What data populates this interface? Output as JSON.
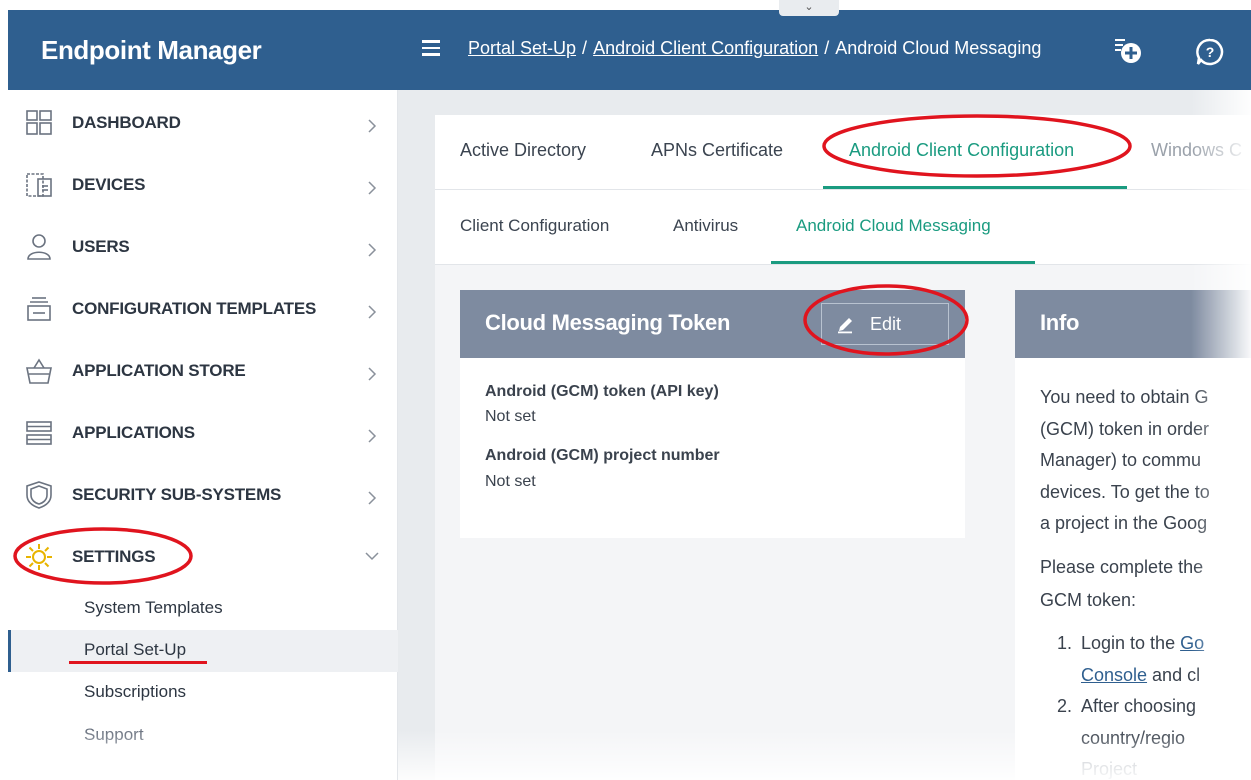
{
  "app": {
    "title": "Endpoint Manager"
  },
  "breadcrumb": {
    "items": [
      "Portal Set-Up",
      "Android Client Configuration",
      "Android Cloud Messaging"
    ],
    "separator": "/"
  },
  "collapse_toggle": {
    "glyph": "⌄",
    "icon": "chevron-down-icon"
  },
  "topbar_icons": {
    "add": "add-icon",
    "help": "help-icon"
  },
  "sidebar": {
    "items": [
      {
        "label": "DASHBOARD",
        "icon": "dashboard-icon"
      },
      {
        "label": "DEVICES",
        "icon": "devices-icon"
      },
      {
        "label": "USERS",
        "icon": "user-icon"
      },
      {
        "label": "CONFIGURATION TEMPLATES",
        "icon": "templates-icon"
      },
      {
        "label": "APPLICATION STORE",
        "icon": "store-basket-icon"
      },
      {
        "label": "APPLICATIONS",
        "icon": "applications-icon"
      },
      {
        "label": "SECURITY SUB-SYSTEMS",
        "icon": "shield-icon"
      },
      {
        "label": "SETTINGS",
        "icon": "gear-icon"
      }
    ],
    "settings_subitems": [
      {
        "label": "System Templates"
      },
      {
        "label": "Portal Set-Up",
        "active": true
      },
      {
        "label": "Subscriptions"
      },
      {
        "label": "Support"
      }
    ]
  },
  "tabs_primary": [
    {
      "label": "Active Directory"
    },
    {
      "label": "APNs Certificate"
    },
    {
      "label": "Android Client Configuration",
      "active": true
    },
    {
      "label": "Windows C"
    }
  ],
  "tabs_secondary": [
    {
      "label": "Client Configuration"
    },
    {
      "label": "Antivirus"
    },
    {
      "label": "Android Cloud Messaging",
      "active": true
    }
  ],
  "token_card": {
    "title": "Cloud Messaging Token",
    "edit_label": "Edit",
    "fields": [
      {
        "label": "Android (GCM) token (API key)",
        "value": "Not set"
      },
      {
        "label": "Android (GCM) project number",
        "value": "Not set"
      }
    ]
  },
  "info_card": {
    "title": "Info",
    "paragraph1": "You need to obtain G\n(GCM) token in order\nManager) to commu\ndevices. To get the to\na project in the Goog",
    "paragraph2": "Please complete the\nGCM token:",
    "steps": [
      {
        "num": "1.",
        "text_a": "Login to the ",
        "link_a": "Go",
        "link_b": "Console",
        "text_b": " and cl"
      },
      {
        "num": "2.",
        "text_a": "After choosing",
        "text_c": "country/regio",
        "text_d": "Project"
      }
    ]
  },
  "colors": {
    "header_blue": "#2f5f8f",
    "accent_green": "#1a9b80",
    "card_header_gray": "#7e8ba0",
    "annotation_red": "#e0141e"
  }
}
